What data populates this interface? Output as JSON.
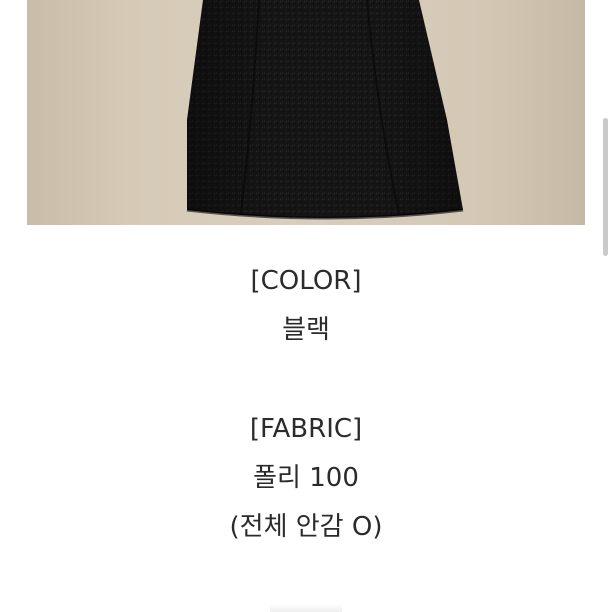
{
  "product_photo": {
    "subject": "black tweed skirt",
    "background_color": "#d6cab7",
    "garment_color": "#141414"
  },
  "details": {
    "color_heading": "[COLOR]",
    "color_value": "블랙",
    "fabric_heading": "[FABRIC]",
    "fabric_value": "폴리 100",
    "fabric_note": "(전체 안감 O)"
  },
  "colors": {
    "text": "#2b2b2b",
    "scrollbar": "#c9c9c9"
  }
}
